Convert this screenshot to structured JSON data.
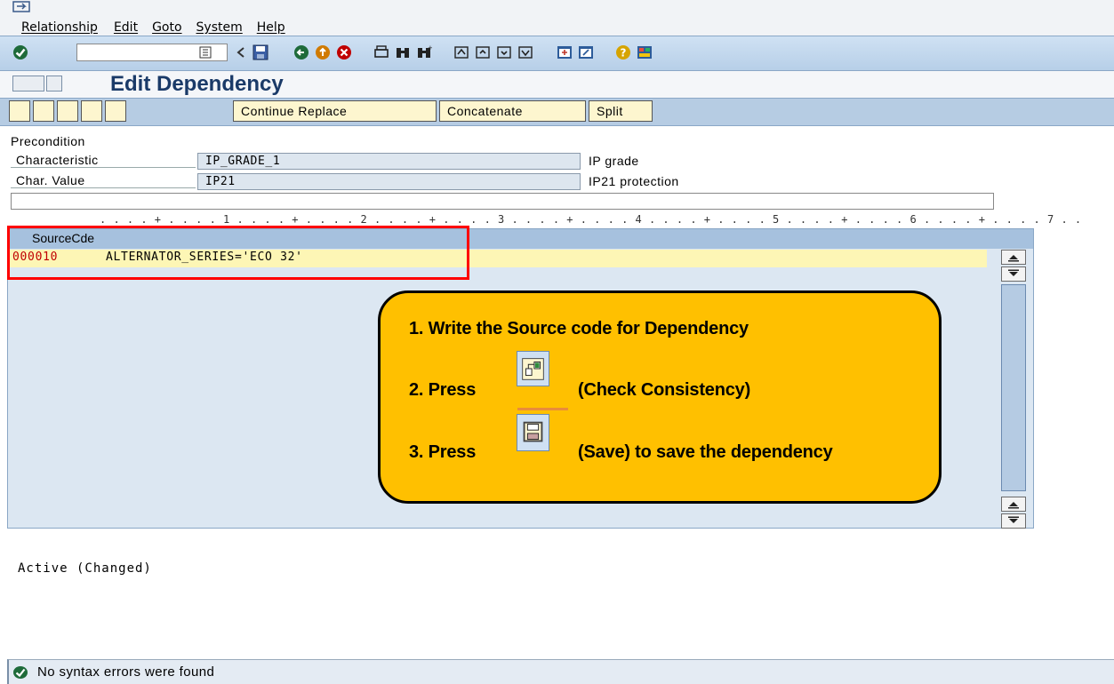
{
  "menu": {
    "items": [
      "Relationship",
      "Edit",
      "Goto",
      "System",
      "Help"
    ]
  },
  "toolbar": {
    "command_field_value": ""
  },
  "title": "Edit Dependency",
  "app_toolbar": {
    "buttons": [
      "Continue Replace",
      "Concatenate",
      "Split"
    ]
  },
  "form": {
    "precondition_label": "Precondition",
    "characteristic_label": "Characteristic",
    "characteristic_value": "IP_GRADE_1",
    "characteristic_desc": "IP grade",
    "char_value_label": "Char. Value",
    "char_value_value": "IP21",
    "char_value_desc": "IP21 protection"
  },
  "ruler": ". . . . + . . . . 1 . . . . + . . . . 2 . . . . + . . . . 3 . . . . + . . . . 4 . . . . + . . . . 5 . . . . + . . . . 6 . . . . + . . . . 7 . .",
  "editor": {
    "header": "SourceCde",
    "line_number": "000010",
    "line_code": "ALTERNATOR_SERIES='ECO 32'"
  },
  "callout": {
    "step1": "1.  Write the Source code for Dependency",
    "step2_prefix": "2. Press",
    "step2_suffix": "(Check Consistency)",
    "step3_prefix": "3. Press",
    "step3_suffix": "(Save) to save the dependency"
  },
  "status_text": "Active  (Changed)",
  "statusbar": {
    "message": "No syntax errors were found"
  },
  "colors": {
    "callout_bg": "#ffc000",
    "highlight_red": "#ff0000",
    "code_line_bg": "#fdf6b5",
    "title_color": "#1a3a68"
  }
}
